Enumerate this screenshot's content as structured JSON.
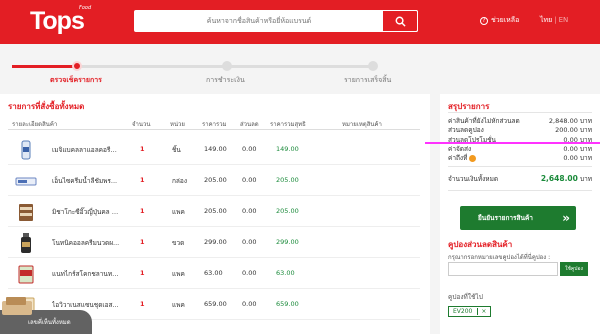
{
  "header": {
    "logo": "Tops",
    "logo_sub": "Food",
    "search_placeholder": "ค้นหาจากชื่อสินค้าหรือยี่ห้อแบรนด์",
    "help": "ช่วยเหลือ",
    "lang_th": "ไทย",
    "lang_sep": "|",
    "lang_en": "EN"
  },
  "steps": [
    {
      "label": "ตรวจเช็ครายการ",
      "active": true
    },
    {
      "label": "การชำระเงิน",
      "active": false
    },
    {
      "label": "รายการเสร็จสิ้น",
      "active": false
    }
  ],
  "cart": {
    "title": "รายการที่สั่งซื้อทั้งหมด",
    "columns": {
      "product": "รายละเอียดสินค้า",
      "qty": "จำนวน",
      "unit": "หน่วย",
      "price": "ราคารวม",
      "discount": "ส่วนลด",
      "net": "ราคารวมสุทธิ",
      "note": "หมายเหตุสินค้า"
    },
    "rows": [
      {
        "name": "เมจิแบคลลาแอลคอรีบินไม่...",
        "qty": "1",
        "unit": "ชิ้น",
        "price": "149.00",
        "discount": "0.00",
        "net": "149.00"
      },
      {
        "name": "เอ็นไซครีมน้ำลีชัมพร...",
        "qty": "1",
        "unit": "กล่อง",
        "price": "205.00",
        "discount": "0.00",
        "net": "205.00"
      },
      {
        "name": "มิชาโกะซีอิ๊วญี่ปุ่นคล 10...",
        "qty": "1",
        "unit": "แพค",
        "price": "205.00",
        "discount": "0.00",
        "net": "205.00"
      },
      {
        "name": "โนทนิคออลครีมนวดผ...",
        "qty": "1",
        "unit": "ขวด",
        "price": "299.00",
        "discount": "0.00",
        "net": "299.00"
      },
      {
        "name": "แนทไกร์สโคกชลานทน...",
        "qty": "1",
        "unit": "แพค",
        "price": "63.00",
        "discount": "0.00",
        "net": "63.00"
      },
      {
        "name": "ไอวิวาเนสแซนชุดเอส...",
        "qty": "1",
        "unit": "แพค",
        "price": "659.00",
        "discount": "0.00",
        "net": "659.00"
      }
    ]
  },
  "summary": {
    "title": "สรุปรายการ",
    "rows": [
      {
        "label": "ค่าสินค้าที่ยังไม่หักส่วนลด",
        "value": "2,848.00 บาท"
      },
      {
        "label": "ส่วนลดคูปอง",
        "value": "200.00 บาท"
      },
      {
        "label": "ส่วนลดโปรโมชั่น",
        "value": "0.00 บาท"
      },
      {
        "label": "ค่าจัดส่ง",
        "value": "0.00 บาท"
      },
      {
        "label": "ค่าถึงที่",
        "value": "0.00 บาท"
      }
    ],
    "total_label": "จำนวนเงินทั้งหมด",
    "total_value": "2,648.00",
    "total_unit": "บาท",
    "confirm_button": "ยืนยันรายการสินค้า",
    "confirm_arrow": "»"
  },
  "coupon": {
    "title": "คูปองส่วนลดสินค้า",
    "subtitle": "กรุณากรอกหมายเลขคูปองได้ที่นี่คูปอง :",
    "button": "ใช้คูปอง",
    "used_label": "คูปองที่ใช้ไป",
    "used_code": "EV200",
    "remove": "×"
  },
  "toast": {
    "text": "เลขคี่เห็นทั้งหมด"
  },
  "colors": {
    "brand": "#e31e24",
    "green": "#1e7b2f",
    "net_green": "#1a8a3a"
  }
}
